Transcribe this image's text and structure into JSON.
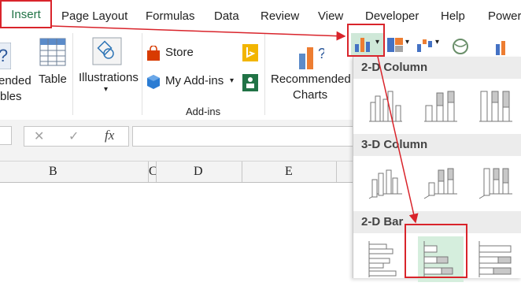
{
  "tabs": [
    {
      "label": "Insert"
    },
    {
      "label": "Page Layout"
    },
    {
      "label": "Formulas"
    },
    {
      "label": "Data"
    },
    {
      "label": "Review"
    },
    {
      "label": "View"
    },
    {
      "label": "Developer"
    },
    {
      "label": "Help"
    },
    {
      "label": "Power"
    }
  ],
  "ribbon": {
    "tables_label_line1": "ended",
    "tables_label_line2": "bles",
    "table_label": "Table",
    "illustrations_label": "Illustrations",
    "store_label": "Store",
    "myaddins_label": "My Add-ins",
    "addins_group_label": "Add-ins",
    "recommended_line1": "Recommended",
    "recommended_line2": "Charts"
  },
  "formula_bar": {
    "cancel_symbol": "✕",
    "enter_symbol": "✓",
    "fx_label": "fx"
  },
  "columns": [
    "B",
    "C",
    "D",
    "E"
  ],
  "dropdown": {
    "sections": [
      {
        "title": "2-D Column"
      },
      {
        "title": "3-D Column"
      },
      {
        "title": "2-D Bar"
      }
    ]
  },
  "colors": {
    "accent_green": "#217346",
    "annotation_red": "#d9242b",
    "selected_bg": "#d5eedd",
    "chart_blue": "#4472c4",
    "chart_orange": "#ed7d31"
  }
}
